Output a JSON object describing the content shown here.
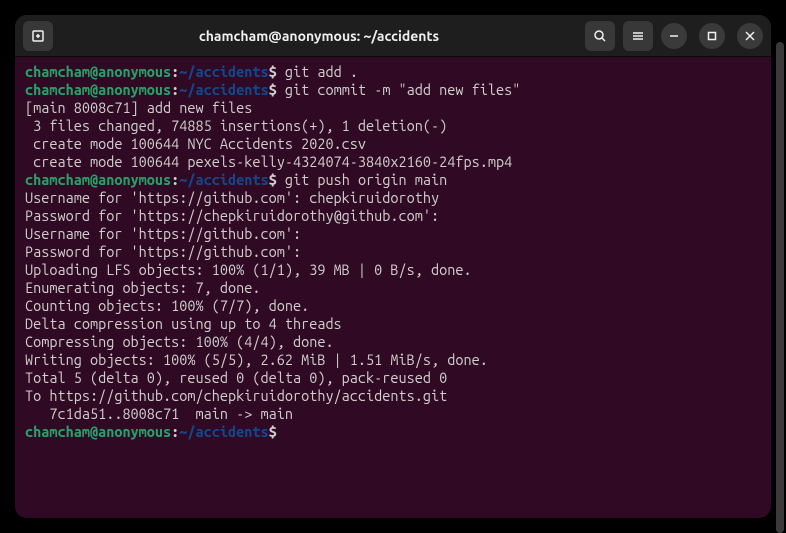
{
  "titlebar": {
    "title": "chamcham@anonymous: ~/accidents"
  },
  "prompt": {
    "user_host": "chamcham@anonymous",
    "path": "~/accidents",
    "symbol": "$"
  },
  "lines": {
    "cmd1": "git add .",
    "cmd2": "git commit -m \"add new files\"",
    "out1": "[main 8008c71] add new files",
    "out2": " 3 files changed, 74885 insertions(+), 1 deletion(-)",
    "out3": " create mode 100644 NYC Accidents 2020.csv",
    "out4": " create mode 100644 pexels-kelly-4324074-3840x2160-24fps.mp4",
    "cmd3": "git push origin main",
    "out5": "Username for 'https://github.com': chepkiruidorothy",
    "out6": "Password for 'https://chepkiruidorothy@github.com': ",
    "out7": "Username for 'https://github.com': ",
    "out8": "Password for 'https://github.com': ",
    "out9": "Uploading LFS objects: 100% (1/1), 39 MB | 0 B/s, done.",
    "out10": "Enumerating objects: 7, done.",
    "out11": "Counting objects: 100% (7/7), done.",
    "out12": "Delta compression using up to 4 threads",
    "out13": "Compressing objects: 100% (4/4), done.",
    "out14": "Writing objects: 100% (5/5), 2.62 MiB | 1.51 MiB/s, done.",
    "out15": "Total 5 (delta 0), reused 0 (delta 0), pack-reused 0",
    "out16": "To https://github.com/chepkiruidorothy/accidents.git",
    "out17": "   7c1da51..8008c71  main -> main"
  }
}
